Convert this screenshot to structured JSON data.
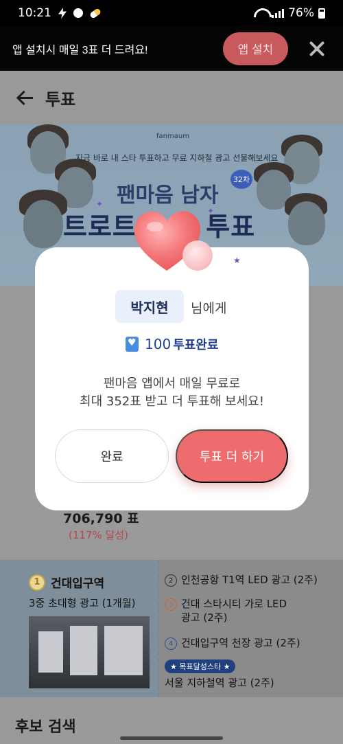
{
  "status_bar": {
    "time": "10:21",
    "battery": "76%"
  },
  "install_banner": {
    "text": "앱 설치시 매일 3표 더 드려요!",
    "install_label": "앱 설치"
  },
  "header": {
    "title": "투표"
  },
  "hero": {
    "brand": "fanmaum",
    "subtitle": "지금 바로 내 스타 투표하고 무료 지하철 광고 선물해보세요",
    "title_line1": "팬마음 남자",
    "title_line2": "트로트  스타 투표",
    "round": "32차"
  },
  "background": {
    "votes": "706,790 표",
    "percent": "(117% 달성)",
    "ad_main": {
      "number": "1",
      "title": "건대입구역",
      "subtitle": "3중 초대형 광고 (1개월)"
    },
    "ad_items": [
      {
        "number": "2",
        "text": "인천공항 T1역 LED 광고 (2주)"
      },
      {
        "number": "3",
        "text": "건대 스타시티 가로 LED 광고 (2주)"
      },
      {
        "number": "4",
        "text": "건대입구역 천장 광고 (2주)"
      }
    ],
    "star_badge": "★ 목표달성스타 ★",
    "ad_last": "서울 지하철역 광고 (2주)",
    "search_title": "후보 검색"
  },
  "modal": {
    "candidate_name": "박지현",
    "name_suffix": "님에게",
    "vote_count": "100",
    "vote_label": "투표완료",
    "message_line1": "팬마음 앱에서 매일 무료로",
    "message_line2": "최대 352표 받고 더 투표해 보세요!",
    "done_label": "완료",
    "more_label": "투표 더 하기"
  },
  "colors": {
    "accent": "#ee6b6e",
    "navy": "#1f3f8a",
    "chip_bg": "#e9f0fb"
  }
}
